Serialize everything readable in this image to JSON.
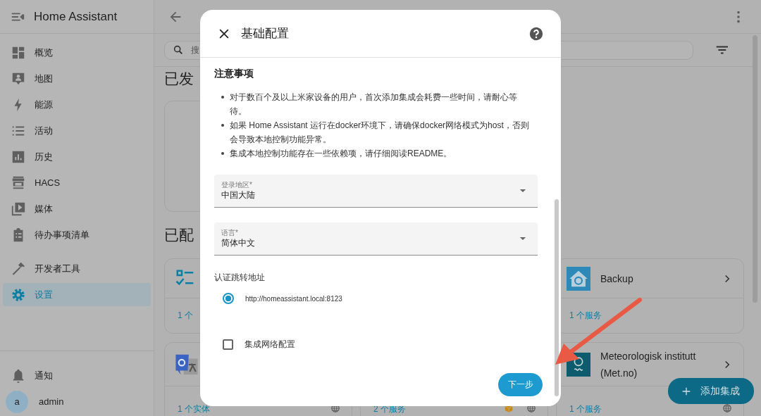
{
  "sidebar": {
    "title": "Home Assistant",
    "items": [
      {
        "label": "概览",
        "selected": false
      },
      {
        "label": "地图",
        "selected": false
      },
      {
        "label": "能源",
        "selected": false
      },
      {
        "label": "活动",
        "selected": false
      },
      {
        "label": "历史",
        "selected": false
      },
      {
        "label": "HACS",
        "selected": false
      },
      {
        "label": "媒体",
        "selected": false
      },
      {
        "label": "待办事项清单",
        "selected": false
      },
      {
        "label": "开发者工具",
        "selected": false
      },
      {
        "label": "设置",
        "selected": true
      }
    ],
    "notifications": "通知",
    "user": {
      "avatar": "a",
      "name": "admin"
    }
  },
  "main": {
    "search_placeholder": "搜",
    "discovered_heading": "已发",
    "configured_heading": "已配",
    "cards": [
      {
        "footer": "1 个"
      },
      {
        "title": "Backup",
        "footer": "1 个服务"
      },
      {
        "footer": "1 个实体"
      },
      {
        "footer": "2 个服务"
      },
      {
        "title": "Meteorologisk institutt (Met.no)",
        "footer": "1 个服务"
      }
    ],
    "fab": "添加集成"
  },
  "dialog": {
    "title": "基础配置",
    "notice_heading": "注意事项",
    "notices": [
      "对于数百个及以上米家设备的用户，首次添加集成会耗费一些时间，请耐心等待。",
      "如果 Home Assistant 运行在docker环境下，请确保docker网络模式为host，否则会导致本地控制功能异常。",
      "集成本地控制功能存在一些依赖项，请仔细阅读README。"
    ],
    "selects": [
      {
        "label": "登录地区*",
        "value": "中国大陆"
      },
      {
        "label": "语言*",
        "value": "简体中文"
      }
    ],
    "redirect_label": "认证跳转地址",
    "redirect_options": [
      {
        "label": "http://homeassistant.local:8123",
        "selected": true
      }
    ],
    "network_option": {
      "label": "集成网络配置",
      "checked": false
    },
    "next_button": "下一步"
  }
}
